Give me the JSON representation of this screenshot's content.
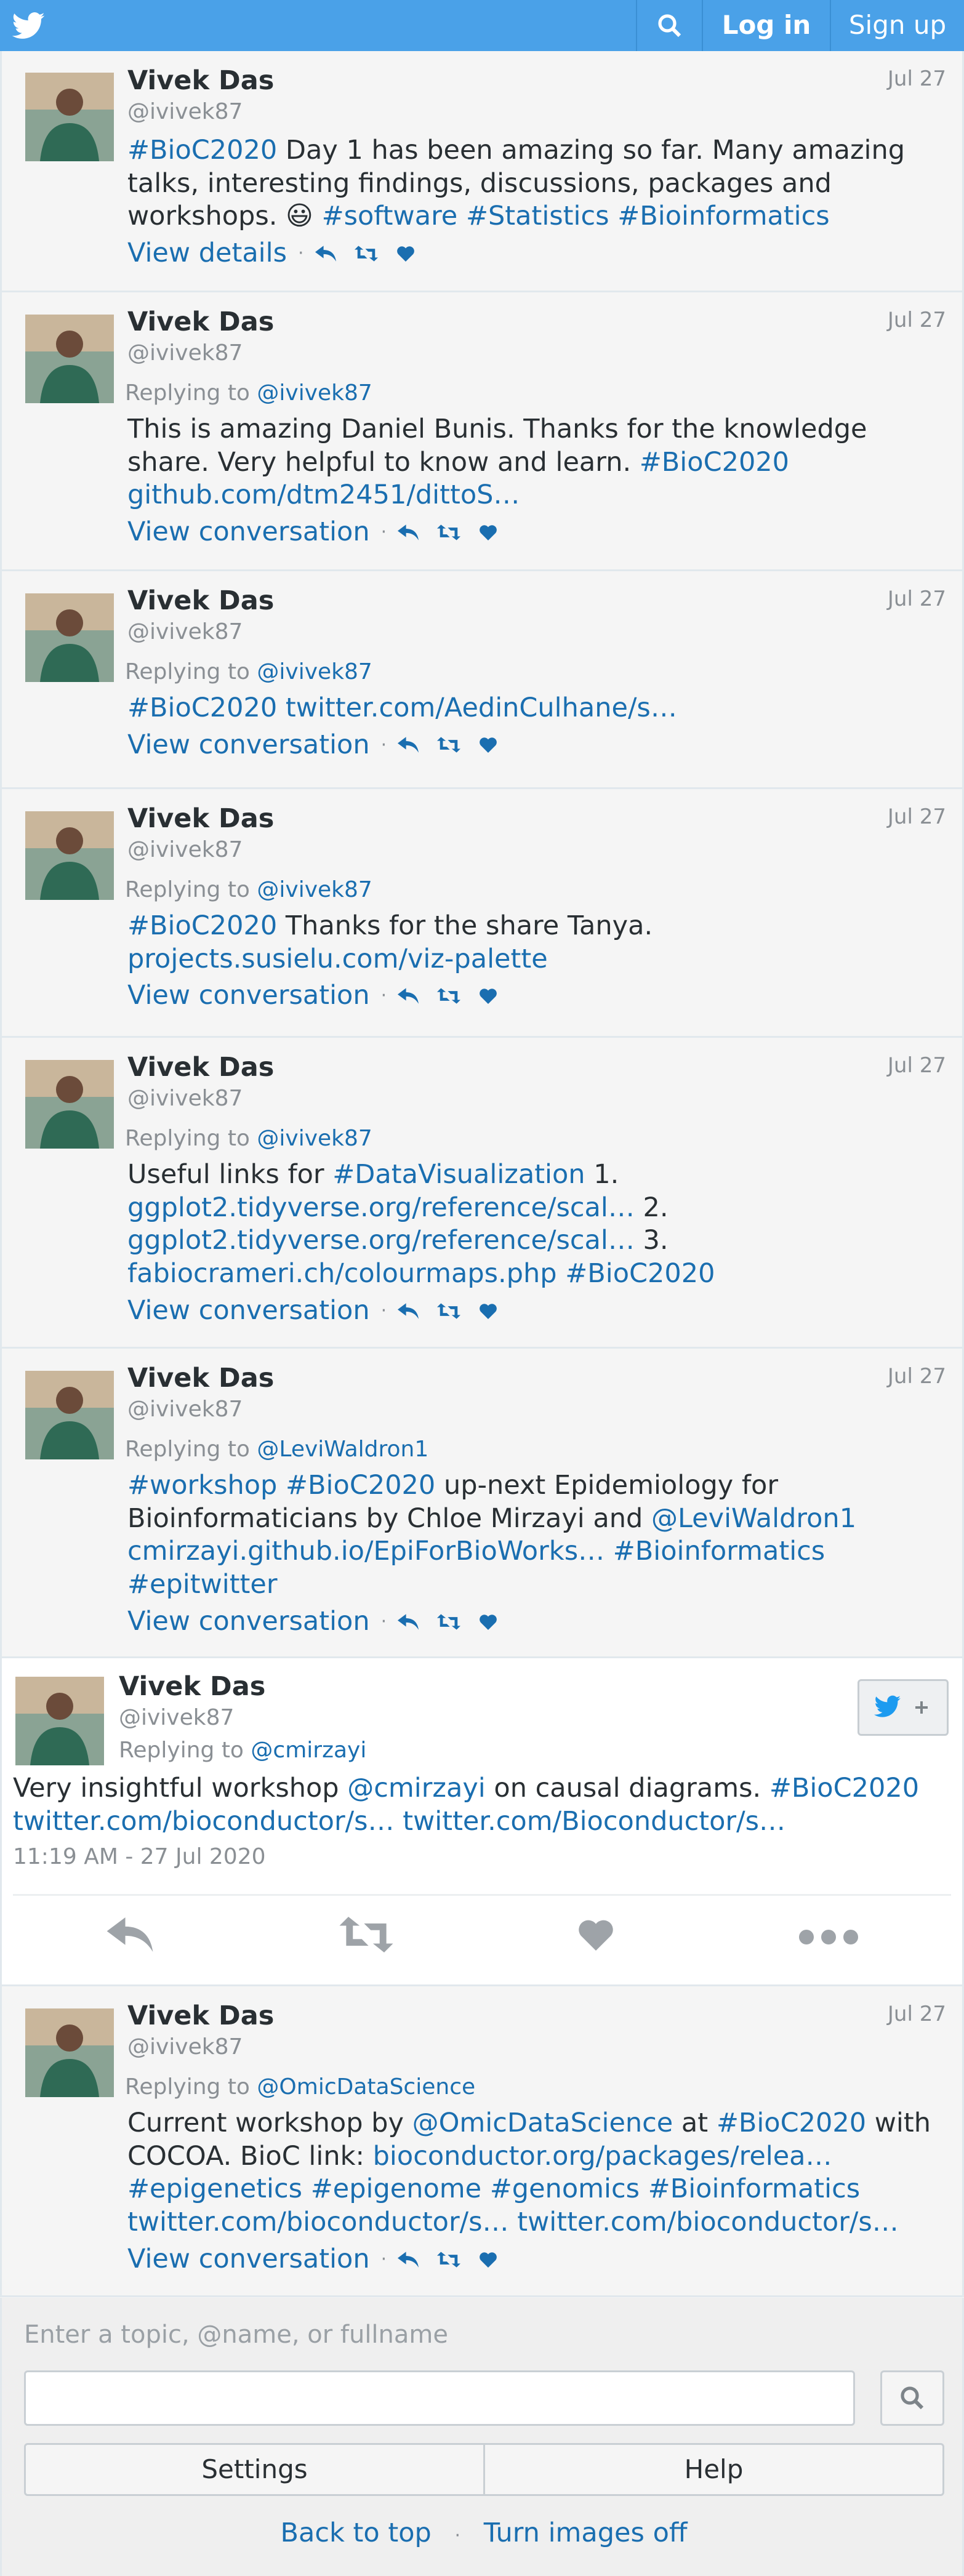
{
  "topbar": {
    "logo_icon": "twitter-bird-icon",
    "search_icon": "search-icon",
    "login_label": "Log in",
    "signup_label": "Sign up"
  },
  "tweets": [
    {
      "name": "Vivek Das",
      "handle": "@ivivek87",
      "date": "Jul 27",
      "text_html": "<span class='link'>#BioC2020</span> Day 1 has been amazing so far. Many amazing talks, interesting findings, discussions, packages and workshops. 😃 <span class='link'>#software</span> <span class='link'>#Statistics</span> <span class='link'>#Bioinformatics</span>",
      "action_label": "View details"
    },
    {
      "name": "Vivek Das",
      "handle": "@ivivek87",
      "date": "Jul 27",
      "reply_prefix": "Replying to",
      "reply_to": "@ivivek87",
      "text_html": "This is amazing Daniel Bunis. Thanks for the knowledge share. Very helpful to know and learn. <span class='link'>#BioC2020</span> <span class='link'>github.com/dtm2451/dittoS…</span>",
      "action_label": "View conversation"
    },
    {
      "name": "Vivek Das",
      "handle": "@ivivek87",
      "date": "Jul 27",
      "reply_prefix": "Replying to",
      "reply_to": "@ivivek87",
      "text_html": "<span class='link'>#BioC2020</span> <span class='link'>twitter.com/AedinCulhane/s…</span>",
      "action_label": "View conversation"
    },
    {
      "name": "Vivek Das",
      "handle": "@ivivek87",
      "date": "Jul 27",
      "reply_prefix": "Replying to",
      "reply_to": "@ivivek87",
      "text_html": "<span class='link'>#BioC2020</span> Thanks for the share Tanya. <span class='link'>projects.susielu.com/viz-palette</span>",
      "action_label": "View conversation"
    },
    {
      "name": "Vivek Das",
      "handle": "@ivivek87",
      "date": "Jul 27",
      "reply_prefix": "Replying to",
      "reply_to": "@ivivek87",
      "text_html": "Useful links for <span class='link'>#DataVisualization</span> 1. <span class='link'>ggplot2.tidyverse.org/reference/scal…</span> 2. <span class='link'>ggplot2.tidyverse.org/reference/scal…</span> 3. <span class='link'>fabiocrameri.ch/colourmaps.php</span> <span class='link'>#BioC2020</span>",
      "action_label": "View conversation"
    },
    {
      "name": "Vivek Das",
      "handle": "@ivivek87",
      "date": "Jul 27",
      "reply_prefix": "Replying to",
      "reply_to": "@LeviWaldron1",
      "text_html": "<span class='link'>#workshop</span> <span class='link'>#BioC2020</span> up-next Epidemiology for Bioinformaticians by Chloe Mirzayi and <span class='link'>@LeviWaldron1</span> <span class='link'>cmirzayi.github.io/EpiForBioWorks…</span> <span class='link'>#Bioinformatics</span> <span class='link'>#epitwitter</span>",
      "action_label": "View conversation"
    }
  ],
  "expanded": {
    "name": "Vivek Das",
    "handle": "@ivivek87",
    "reply_prefix": "Replying to",
    "reply_to": "@cmirzayi",
    "text_html": "Very insightful workshop <span class='link'>@cmirzayi</span> on causal diagrams. <span class='link'>#BioC2020</span> <span class='link'>twitter.com/bioconductor/s…</span> <span class='link'>twitter.com/Bioconductor/s…</span>",
    "timestamp": "11:19 AM - 27 Jul 2020",
    "follow_icon": "follow-bird-plus-icon"
  },
  "last_tweet": {
    "name": "Vivek Das",
    "handle": "@ivivek87",
    "date": "Jul 27",
    "reply_prefix": "Replying to",
    "reply_to": "@OmicDataScience",
    "text_html": "Current workshop by <span class='link'>@OmicDataScience</span> at <span class='link'>#BioC2020</span> with COCOA. BioC link: <span class='link'>bioconductor.org/packages/relea…</span> <span class='link'>#epigenetics</span> <span class='link'>#epigenome</span> <span class='link'>#genomics</span> <span class='link'>#Bioinformatics</span> <span class='link'>twitter.com/bioconductor/s…</span> <span class='link'>twitter.com/bioconductor/s…</span>",
    "action_label": "View conversation"
  },
  "footer": {
    "search_placeholder": "Enter a topic, @name, or fullname",
    "settings_label": "Settings",
    "help_label": "Help",
    "back_to_top": "Back to top",
    "dot": "·",
    "turn_images_off": "Turn images off"
  },
  "colors": {
    "topbar": "#4aa1e8",
    "link": "#1a6eb0",
    "muted": "#8a8f94"
  }
}
